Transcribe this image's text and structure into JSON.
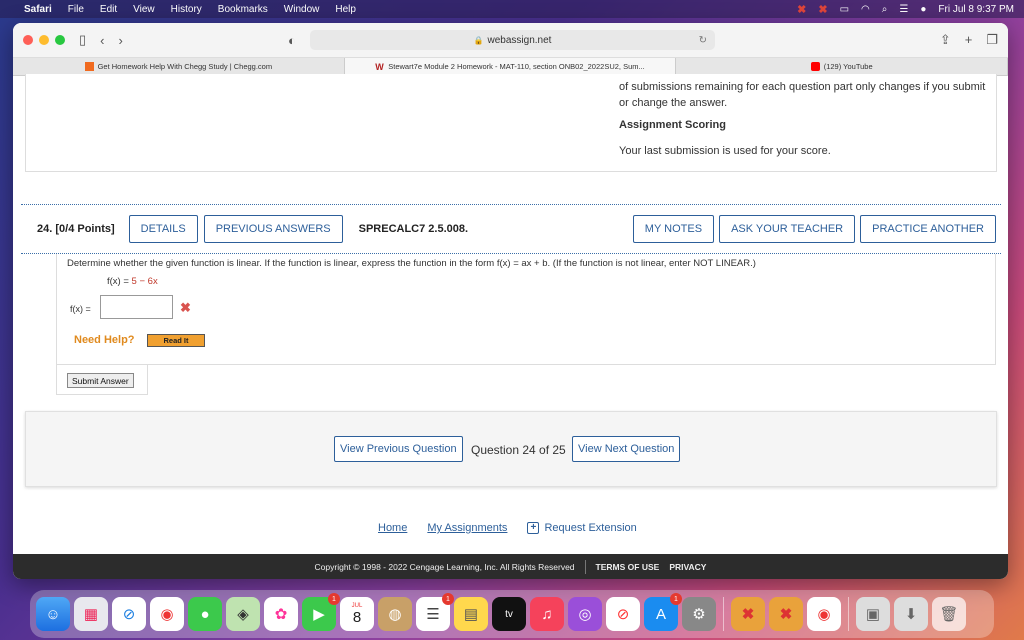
{
  "menubar": {
    "app": "Safari",
    "items": [
      "File",
      "Edit",
      "View",
      "History",
      "Bookmarks",
      "Window",
      "Help"
    ],
    "datetime": "Fri Jul 8  9:37 PM"
  },
  "browser": {
    "url": "webassign.net",
    "tabs": [
      {
        "label": "Get Homework Help With Chegg Study | Chegg.com",
        "icon": "chegg-icon",
        "color": "#f06a1f"
      },
      {
        "label": "Stewart7e Module 2 Homework - MAT-110, section ONB02_2022SU2, Sum...",
        "icon": "webassign-icon",
        "color": "#b22222"
      },
      {
        "label": "(129) YouTube",
        "icon": "youtube-icon",
        "color": "#ff0000"
      }
    ]
  },
  "previous": {
    "submissions_text": "of submissions remaining for each question part only changes if you submit or change the answer.",
    "scoring_title": "Assignment Scoring",
    "scoring_text": "Your last submission is used for your score."
  },
  "question": {
    "number": "24.",
    "points": "[0/4 Points]",
    "details_label": "DETAILS",
    "previous_answers_label": "PREVIOUS ANSWERS",
    "code": "SPRECALC7 2.5.008.",
    "my_notes_label": "MY NOTES",
    "ask_teacher_label": "ASK YOUR TEACHER",
    "practice_another_label": "PRACTICE ANOTHER",
    "prompt": "Determine whether the given function is linear. If the function is linear, express the function in the form  f(x) = ax + b.  (If the function is not linear, enter NOT LINEAR.)",
    "given_prefix": "f(x) = ",
    "given_expr": "5 − 6x",
    "answer_label": "f(x) =",
    "answer_value": "",
    "need_help": "Need Help?",
    "read_it": "Read It",
    "submit_label": "Submit Answer"
  },
  "navigation": {
    "prev_label": "View Previous Question",
    "counter": "Question 24 of 25",
    "next_label": "View Next Question"
  },
  "footer": {
    "home": "Home",
    "assignments": "My Assignments",
    "extension": "Request Extension",
    "copyright": "Copyright © 1998 - 2022 Cengage Learning, Inc. All Rights Reserved",
    "terms": "TERMS OF USE",
    "privacy": "PRIVACY"
  },
  "dock": {
    "calendar_month": "JUL",
    "calendar_day": "8",
    "badges": {
      "facetime": "1",
      "reminders": "1",
      "appstore": "1"
    }
  },
  "colors": {
    "link_blue": "#2d5f9a",
    "error_red": "#d9534f",
    "help_orange": "#e08a1e"
  }
}
